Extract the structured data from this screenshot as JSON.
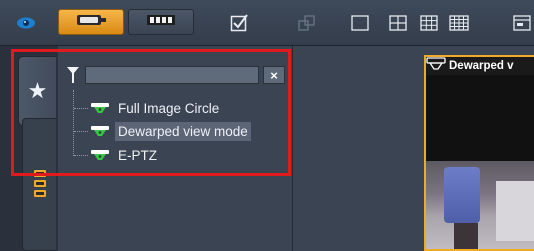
{
  "toolbar": {
    "icons": [
      "eye-icon",
      "camera-icon",
      "camera-rail-icon",
      "checkbox-icon",
      "link-icon",
      "layout-1x1-icon",
      "layout-2x2-icon",
      "layout-3x3-icon",
      "layout-4x4-icon",
      "layout-wide-icon"
    ]
  },
  "sidebar_tabs": [
    "star-icon",
    "camera-group-icon"
  ],
  "tree_panel": {
    "search": {
      "value": "",
      "placeholder": ""
    },
    "clear_label": "×",
    "items": [
      {
        "label": "Full Image Circle",
        "selected": false
      },
      {
        "label": "Dewarped view mode",
        "selected": true
      },
      {
        "label": "E-PTZ",
        "selected": false
      }
    ]
  },
  "view": {
    "title": "Dewarped v"
  },
  "colors": {
    "accent": "#f0a928",
    "highlight": "#e01b1b",
    "camera_green": "#3ec24a"
  }
}
